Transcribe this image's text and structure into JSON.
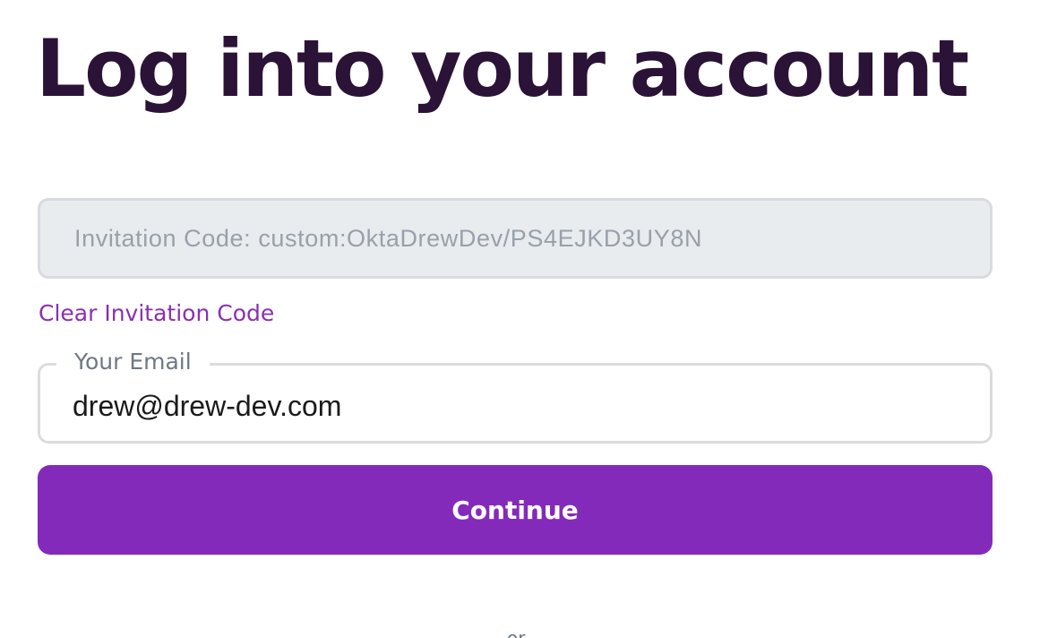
{
  "page": {
    "title": "Log into your account"
  },
  "invitation": {
    "value": "Invitation Code: custom:OktaDrewDev/PS4EJKD3UY8N",
    "clear_label": "Clear Invitation Code"
  },
  "email": {
    "label": "Your Email",
    "value": "drew@drew-dev.com"
  },
  "actions": {
    "continue_label": "Continue"
  },
  "divider": {
    "text": "or"
  },
  "colors": {
    "title": "#2a1336",
    "accent": "#842abb",
    "link": "#8a2fb3",
    "disabled_field_bg": "#e9ecef",
    "muted_text": "#98a0aa"
  }
}
